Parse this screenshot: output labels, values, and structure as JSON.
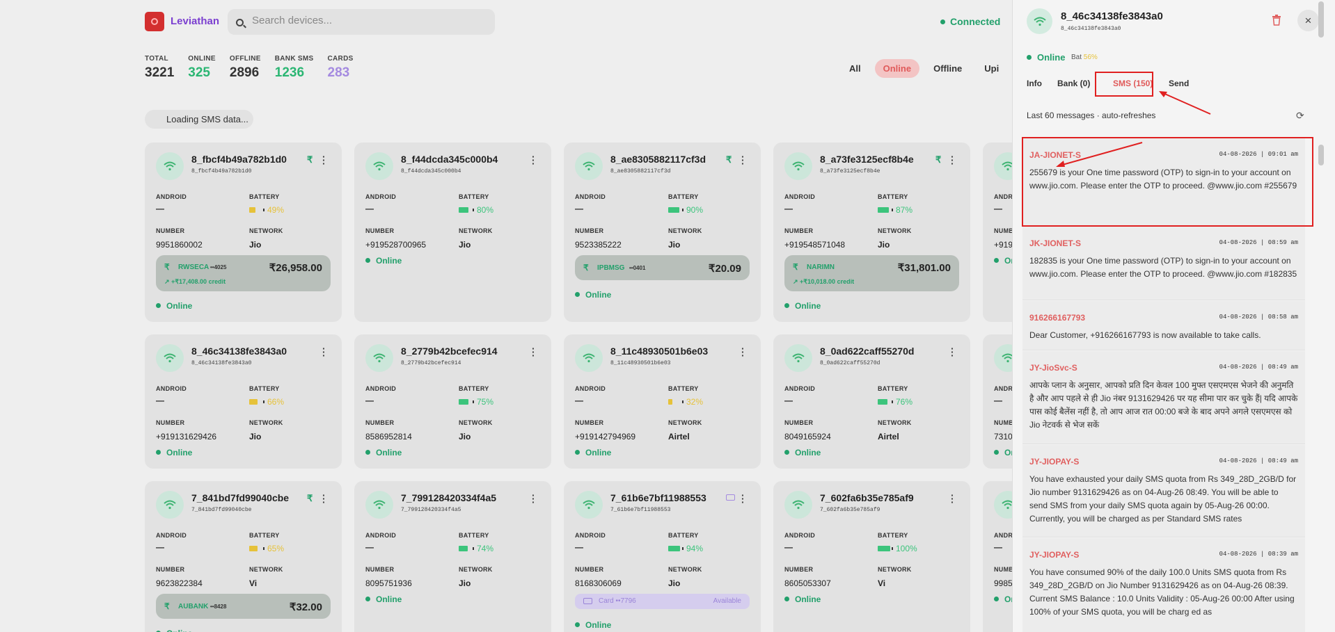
{
  "app": {
    "brand": "Leviathan",
    "search_placeholder": "Search devices...",
    "connection": "Connected"
  },
  "stats": [
    {
      "label": "TOTAL",
      "value": "3221",
      "color": "#333333"
    },
    {
      "label": "ONLINE",
      "value": "325",
      "color": "#2bb673"
    },
    {
      "label": "OFFLINE",
      "value": "2896",
      "color": "#333333"
    },
    {
      "label": "BANK SMS",
      "value": "1236",
      "color": "#2bb673"
    },
    {
      "label": "CARDS",
      "value": "283",
      "color": "#a48ae0"
    }
  ],
  "filters": [
    "All",
    "Online",
    "Offline",
    "Upi"
  ],
  "loading_text": "Loading SMS data...",
  "card_labels": {
    "os": "ANDROID",
    "battery": "BATTERY",
    "number": "NUMBER",
    "network": "NETWORK",
    "os_value": "—",
    "online": "Online"
  },
  "devices": [
    {
      "id": "8_fbcf4b49a782b1d0",
      "battery": "49%",
      "battery_level": 0.49,
      "number": "9951860002",
      "network": "Jio",
      "has_rupee": true,
      "bank": {
        "name": "RWSECA",
        "acct": "••4025",
        "amount": "₹26,958.00",
        "credit": "+₹17,408.00 credit"
      },
      "status": "Online"
    },
    {
      "id": "8_f44dcda345c000b4",
      "battery": "80%",
      "battery_level": 0.8,
      "number": "+919528700965",
      "network": "Jio",
      "has_rupee": false,
      "status": "Online"
    },
    {
      "id": "8_ae8305882117cf3d",
      "battery": "90%",
      "battery_level": 0.9,
      "number": "9523385222",
      "network": "Jio",
      "has_rupee": true,
      "bank": {
        "name": "IPBMSG",
        "acct": "••0401",
        "amount": "₹20.09"
      },
      "status": "Online"
    },
    {
      "id": "8_a73fe3125ecf8b4e",
      "battery": "87%",
      "battery_level": 0.87,
      "number": "+919548571048",
      "network": "Jio",
      "has_rupee": true,
      "bank": {
        "name": "NARIMN",
        "amount": "₹31,801.00",
        "credit": "+₹10,018.00 credit"
      },
      "status": "Online"
    },
    {
      "id": "8_46c34138fe3843a0",
      "battery": "66%",
      "battery_level": 0.66,
      "number": "+919131629426",
      "network": "Jio",
      "has_rupee": false,
      "status": "Online"
    },
    {
      "id": "8_2779b42bcefec914",
      "battery": "75%",
      "battery_level": 0.75,
      "number": "8586952814",
      "network": "Jio",
      "has_rupee": false,
      "status": "Online"
    },
    {
      "id": "8_11c48930501b6e03",
      "battery": "32%",
      "battery_level": 0.32,
      "number": "+919142794969",
      "network": "Airtel",
      "has_rupee": false,
      "status": "Online"
    },
    {
      "id": "8_0ad622caff55270d",
      "battery": "76%",
      "battery_level": 0.76,
      "number": "8049165924",
      "network": "Airtel",
      "has_rupee": false,
      "status": "Online"
    },
    {
      "id": "7_841bd7fd99040cbe",
      "battery": "65%",
      "battery_level": 0.65,
      "number": "9623822384",
      "network": "Vi",
      "has_rupee": true,
      "bank": {
        "name": "AUBANK",
        "acct": "••8428",
        "amount": "₹32.00"
      },
      "status": "Online"
    },
    {
      "id": "7_799128420334f4a5",
      "battery": "74%",
      "battery_level": 0.74,
      "number": "8095751936",
      "network": "Jio",
      "has_rupee": false,
      "status": "Online"
    },
    {
      "id": "7_61b6e7bf11988553",
      "battery": "94%",
      "battery_level": 0.94,
      "number": "8168306069",
      "network": "Jio",
      "has_card_icon": true,
      "card": {
        "label": "Card ••7796",
        "state": "Available"
      },
      "status": "Online"
    },
    {
      "id": "7_602fa6b35e785af9",
      "battery": "100%",
      "battery_level": 1.0,
      "number": "8605053307",
      "network": "Vi",
      "has_rupee": false,
      "status": "Online"
    }
  ],
  "partial_column": {
    "numbers": [
      "+919",
      "7310",
      "9985"
    ],
    "online": "On"
  },
  "panel": {
    "title": "8_46c34138fe3843a0",
    "subtitle": "8_46c34138fe3843a0",
    "status": "Online",
    "battery_label": "Bat",
    "battery_value": "56%",
    "tabs": [
      "Info",
      "Bank (0)",
      "SMS (150)",
      "Send"
    ],
    "active_tab": "SMS (150)",
    "meta": "Last 60 messages · auto-refreshes",
    "messages": [
      {
        "sender": "JA-JIONET-S",
        "date": "04-08-2026 | 09:01 am",
        "body": "255679 is your One time password (OTP) to sign-in to your account on www.jio.com. Please enter the OTP to proceed. @www.jio.com #255679"
      },
      {
        "sender": "JK-JIONET-S",
        "date": "04-08-2026 | 08:59 am",
        "body": "182835 is your One time password (OTP) to sign-in to your account on www.jio.com. Please enter the OTP to proceed. @www.jio.com #182835"
      },
      {
        "sender": "916266167793",
        "date": "04-08-2026 | 08:58 am",
        "body": "Dear Customer, +916266167793 is now available to take calls."
      },
      {
        "sender": "JY-JioSvc-S",
        "date": "04-08-2026 | 08:49 am",
        "body": "आपके प्लान के अनुसार, आपको प्रति दिन केवल 100 मुफ्त एसएमएस भेजने की अनुमति है और आप पहले से ही Jio नंबर 9131629426 पर यह सीमा पार कर चुके हैं| यदि आपके पास कोई बैलेंस नहीं है, तो आप आज रात 00:00 बजे के बाद अपने अगले एसएमएस को Jio नेटवर्क से भेज सकें"
      },
      {
        "sender": "JY-JIOPAY-S",
        "date": "04-08-2026 | 08:49 am",
        "body": "You have exhausted your daily SMS quota from Rs 349_28D_2GB/D for Jio number 9131629426 as on 04-Aug-26 08:49. You will be able to send SMS from your daily SMS quota again by 05-Aug-26 00:00. Currently, you will be charged as per Standard SMS rates"
      },
      {
        "sender": "JY-JIOPAY-S",
        "date": "04-08-2026 | 08:39 am",
        "body": "You have consumed 90% of the daily 100.0 Units SMS quota from Rs 349_28D_2GB/D on Jio Number 9131629426 as on 04-Aug-26 08:39. Current SMS Balance : 10.0 Units Validity : 05-Aug-26 00:00 After using 100% of your SMS quota, you will be charg ed as"
      }
    ]
  },
  "colors": {
    "accent": "#e05a5a",
    "online": "#22a06b",
    "highlight": "#e02020",
    "battery_low": "#e6c23a",
    "battery_ok": "#3cc47c"
  }
}
